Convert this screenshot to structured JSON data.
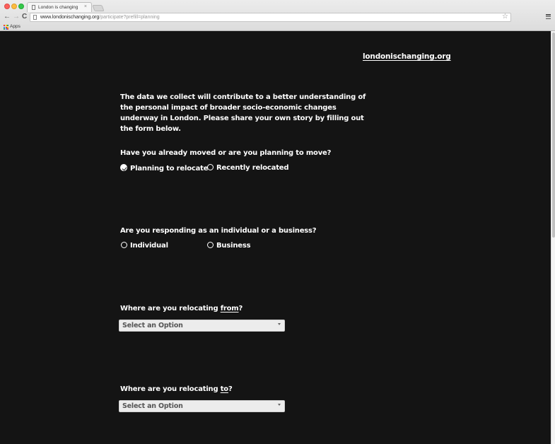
{
  "browser": {
    "tab_title": "London is changing",
    "tab_close": "×",
    "url_host": "www.londonischanging.org",
    "url_path": "/participate?prefill=planning",
    "back_icon": "←",
    "forward_icon": "→",
    "reload_icon": "C",
    "bookmark_star_icon": "☆",
    "bookmarks": [
      {
        "label": "Apps"
      }
    ]
  },
  "site": {
    "link": "londonischanging.org"
  },
  "intro": "The data we collect will contribute to a better understanding of the personal impact of broader socio-economic changes underway in London. Please share your own story by filling out the form below.",
  "form": {
    "q1": {
      "label": "Have you already moved or are you planning to move?",
      "options": [
        {
          "label": "Planning to relocate",
          "checked": true
        },
        {
          "label": "Recently relocated",
          "checked": false
        }
      ]
    },
    "q2": {
      "label": "Are you responding as an individual or a business?",
      "options": [
        {
          "label": "Individual",
          "checked": false
        },
        {
          "label": "Business",
          "checked": false
        }
      ]
    },
    "q3": {
      "label_prefix": "Where are you relocating ",
      "label_emphasis": "from",
      "label_suffix": "?",
      "select_value": "Select an Option"
    },
    "q4": {
      "label_prefix": "Where are you relocating ",
      "label_emphasis": "to",
      "label_suffix": "?",
      "select_value": "Select an Option"
    }
  },
  "colors": {
    "page_background": "#141414",
    "text": "#ffffff",
    "select_background": "#ececec"
  }
}
